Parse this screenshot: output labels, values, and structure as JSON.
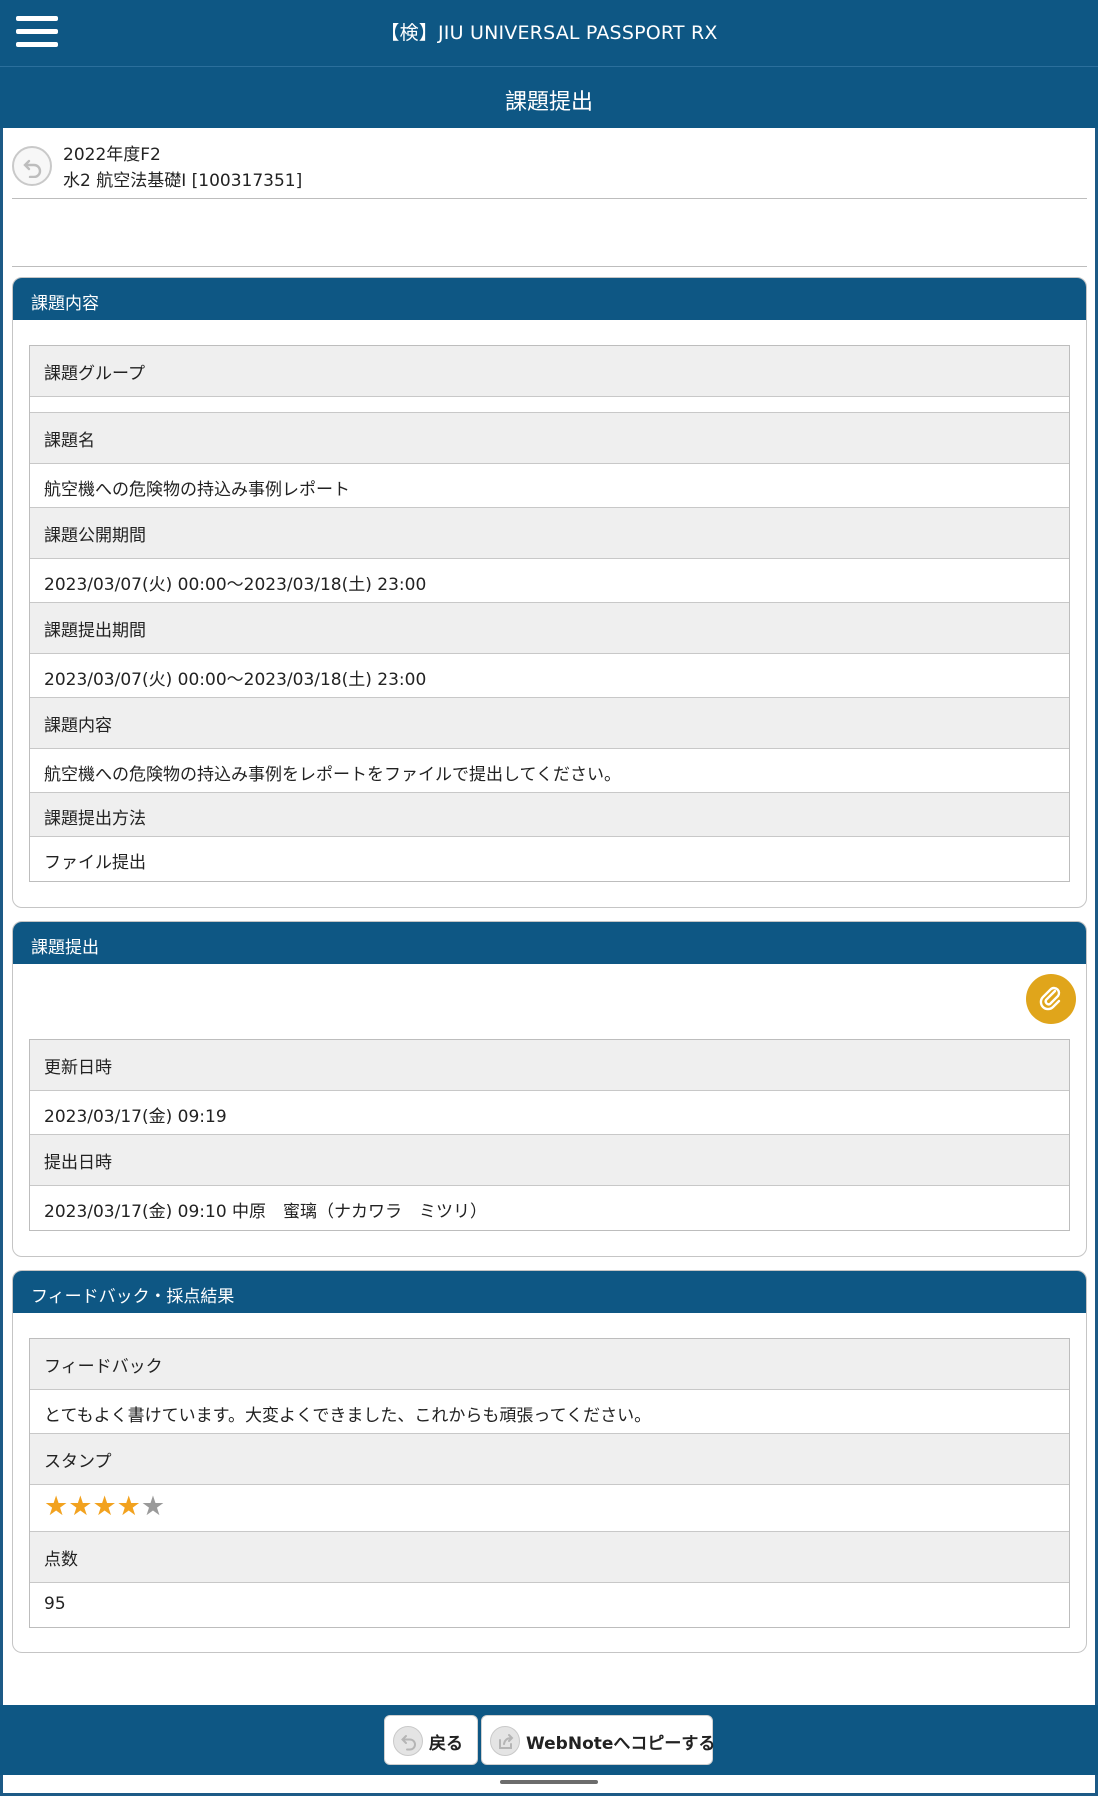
{
  "app": {
    "title": "【検】JIU UNIVERSAL PASSPORT RX"
  },
  "page": {
    "title": "課題提出"
  },
  "course": {
    "year_term": "2022年度F2",
    "name": "水2 航空法基礎Ⅰ [100317351]"
  },
  "assignment_panel": {
    "heading": "課題内容",
    "group_label": "課題グループ",
    "group_value": "",
    "name_label": "課題名",
    "name_value": "航空機への危険物の持込み事例レポート",
    "public_period_label": "課題公開期間",
    "public_period_value": "2023/03/07(火) 00:00～2023/03/18(土) 23:00",
    "submit_period_label": "課題提出期間",
    "submit_period_value": "2023/03/07(火) 00:00～2023/03/18(土) 23:00",
    "content_label": "課題内容",
    "content_value": "航空機への危険物の持込み事例をレポートをファイルで提出してください。",
    "method_label": "課題提出方法",
    "method_value": "ファイル提出"
  },
  "submission_panel": {
    "heading": "課題提出",
    "attachment_icon": "paperclip-icon",
    "updated_label": "更新日時",
    "updated_value": "2023/03/17(金) 09:19",
    "submitted_label": "提出日時",
    "submitted_value": "2023/03/17(金) 09:10  中原　蜜璃（ナカワラ　ミツリ）"
  },
  "feedback_panel": {
    "heading": "フィードバック・採点結果",
    "feedback_label": "フィードバック",
    "feedback_value": "とてもよく書けています。大変よくできました、これからも頑張ってください。",
    "stamp_label": "スタンプ",
    "stamp_rating": 4,
    "stamp_max": 5,
    "score_label": "点数",
    "score_value": "95"
  },
  "bottom": {
    "back_label": "戻る",
    "copy_label": "WebNoteへコピーする"
  },
  "colors": {
    "brand": "#0e5784",
    "star": "#f2a21f",
    "clip": "#e0a51b"
  }
}
